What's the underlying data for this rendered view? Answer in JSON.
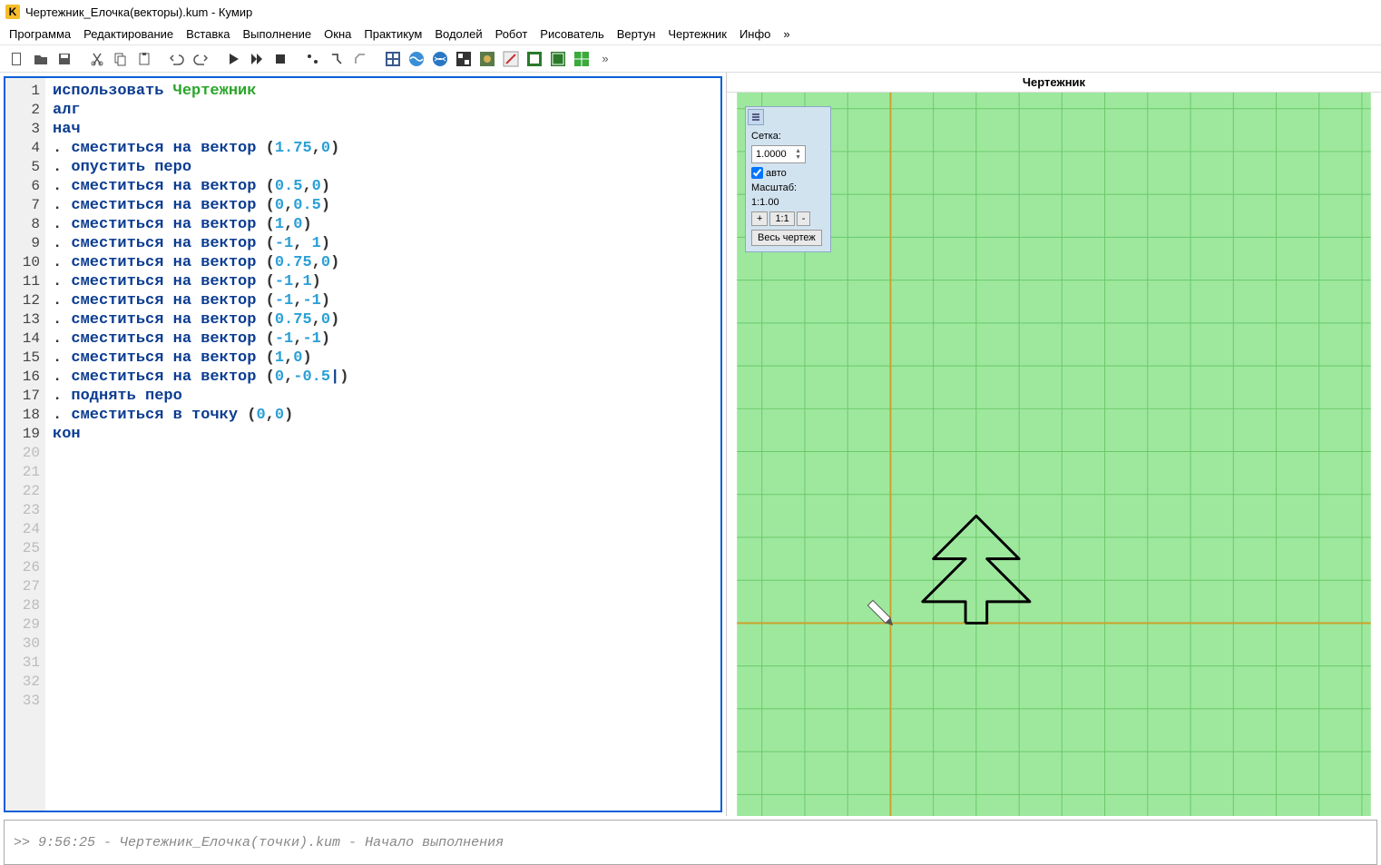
{
  "title": "Чертежник_Елочка(векторы).kum - Кумир",
  "menu": [
    "Программа",
    "Редактирование",
    "Вставка",
    "Выполнение",
    "Окна",
    "Практикум",
    "Водолей",
    "Робот",
    "Рисователь",
    "Вертун",
    "Чертежник",
    "Инфо",
    "»"
  ],
  "rightTitle": "Чертежник",
  "panel": {
    "gridLabel": "Сетка:",
    "gridValue": "1.0000",
    "autoLabel": "авто",
    "scaleLabel": "Масштаб:",
    "scaleValue": "1:1.00",
    "plus": "+",
    "oneToOne": "1:1",
    "minus": "-",
    "fullDrawing": "Весь чертеж"
  },
  "console": ">>  9:56:25 - Чертежник_Елочка(точки).kum - Начало выполнения",
  "gutterLines": 33,
  "codeLines": 19,
  "code": {
    "l1a": "использовать ",
    "l1b": "Чертежник",
    "l2": "алг",
    "l3": "нач",
    "cmd_move": "сместиться на вектор",
    "cmd_point": "сместиться в точку",
    "cmd_pendown": "опустить перо",
    "cmd_penup": "поднять перо",
    "l19": "кон",
    "vec4a": "1.75",
    "vec4b": "0",
    "vec6a": "0.5",
    "vec6b": "0",
    "vec7a": "0",
    "vec7b": "0.5",
    "vec8a": "1",
    "vec8b": "0",
    "vec9a": "-1",
    "vec9b": "1",
    "vec10a": "0.75",
    "vec10b": "0",
    "vec11a": "-1",
    "vec11b": "1",
    "vec12a": "-1",
    "vec12b": "-1",
    "vec13a": "0.75",
    "vec13b": "0",
    "vec14a": "-1",
    "vec14b": "-1",
    "vec15a": "1",
    "vec15b": "0",
    "vec16a": "0",
    "vec16b": "-0.5",
    "vec18a": "0",
    "vec18b": "0"
  }
}
